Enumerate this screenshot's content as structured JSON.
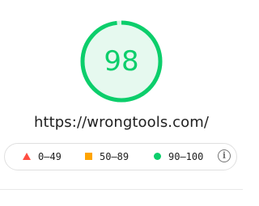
{
  "score": {
    "value": "98",
    "fraction": 0.98,
    "color": "#0cce6b",
    "fill_color": "#e6f9ef"
  },
  "url": "https://wrongtools.com/",
  "legend": {
    "items": [
      {
        "label": "0–49",
        "shape": "triangle",
        "color": "#ff4e42"
      },
      {
        "label": "50–89",
        "shape": "square",
        "color": "#ffa400"
      },
      {
        "label": "90–100",
        "shape": "circle",
        "color": "#0cce6b"
      }
    ],
    "info_icon": "info-icon"
  }
}
